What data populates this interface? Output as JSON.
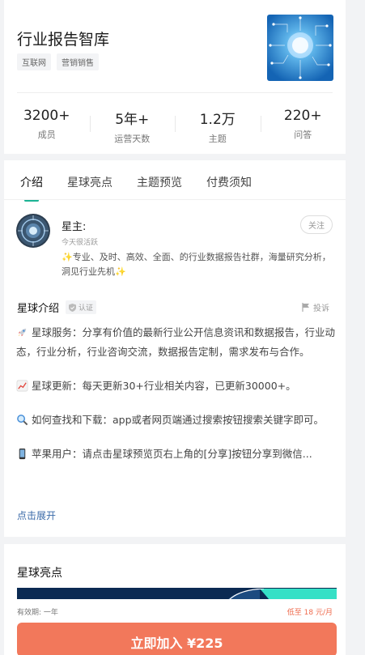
{
  "header": {
    "title": "行业报告智库",
    "tags": [
      "互联网",
      "营销销售"
    ]
  },
  "stats": [
    {
      "value": "3200+",
      "label": "成员"
    },
    {
      "value": "5年+",
      "label": "运营天数"
    },
    {
      "value": "1.2万",
      "label": "主题"
    },
    {
      "value": "220+",
      "label": "问答"
    }
  ],
  "tabs": [
    "介绍",
    "星球亮点",
    "主题预览",
    "付费须知"
  ],
  "owner": {
    "name": "星主:",
    "status": "今天很活跃",
    "follow_label": "关注",
    "description": "✨专业、及时、高效、全面、的行业数据报告社群，海量研究分析，洞见行业先机✨"
  },
  "intro": {
    "title": "星球介绍",
    "verify_label": "认证",
    "report_label": "投诉",
    "paragraphs": [
      {
        "icon": "rocket-icon",
        "text": "星球服务：分享有价值的最新行业公开信息资讯和数据报告，行业动态，行业分析，行业咨询交流，数据报告定制，需求发布与合作。"
      },
      {
        "icon": "chart-increasing-icon",
        "text": "星球更新：每天更新30+行业相关内容，已更新30000+。"
      },
      {
        "icon": "magnifier-icon",
        "text": "如何查找和下载：app或者网页端通过搜索按钮搜索关键字即可。"
      },
      {
        "icon": "phone-icon",
        "text": "苹果用户：请点击星球预览页右上角的[分享]按钮分享到微信..."
      }
    ],
    "expand_label": "点击展开"
  },
  "highlights": {
    "title": "星球亮点"
  },
  "purchase": {
    "validity": "有效期: 一年",
    "price_low": "低至 18 元/月",
    "join_label": "立即加入 ¥225"
  },
  "colors": {
    "accent": "#1bb394",
    "cta": "#f2785b",
    "price": "#ef6a4c",
    "link": "#3a6aa8"
  }
}
